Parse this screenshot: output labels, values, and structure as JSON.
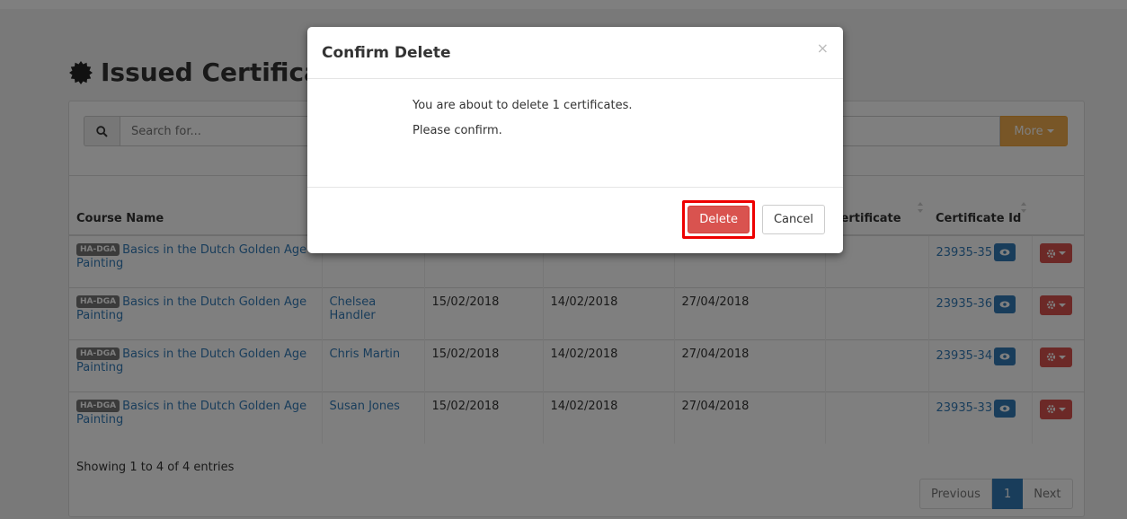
{
  "page": {
    "title": "Issued Certificates"
  },
  "search": {
    "placeholder": "Search for...",
    "more_label": "More"
  },
  "table": {
    "headers": [
      "Course Name",
      "",
      "",
      "",
      "",
      "Certificate",
      "Certificate Id",
      ""
    ],
    "rows": [
      {
        "badge": "HA-DGA",
        "course": "Basics in the Dutch Golden Age Painting",
        "student": "",
        "d1": "",
        "d2": "",
        "d3": "",
        "cert_id": "23935-35"
      },
      {
        "badge": "HA-DGA",
        "course": "Basics in the Dutch Golden Age Painting",
        "student": "Chelsea Handler",
        "d1": "15/02/2018",
        "d2": "14/02/2018",
        "d3": "27/04/2018",
        "cert_id": "23935-36"
      },
      {
        "badge": "HA-DGA",
        "course": "Basics in the Dutch Golden Age Painting",
        "student": "Chris Martin",
        "d1": "15/02/2018",
        "d2": "14/02/2018",
        "d3": "27/04/2018",
        "cert_id": "23935-34"
      },
      {
        "badge": "HA-DGA",
        "course": "Basics in the Dutch Golden Age Painting",
        "student": "Susan Jones",
        "d1": "15/02/2018",
        "d2": "14/02/2018",
        "d3": "27/04/2018",
        "cert_id": "23935-33"
      }
    ]
  },
  "footer": {
    "showing": "Showing 1 to 4 of 4 entries",
    "prev": "Previous",
    "current_page": "1",
    "next": "Next"
  },
  "modal": {
    "title": "Confirm Delete",
    "close": "×",
    "message": "You are about to delete 1 certificates.",
    "confirm_text": "Please confirm.",
    "delete_label": "Delete",
    "cancel_label": "Cancel"
  },
  "icons": {
    "title_icon": "certificate-icon",
    "search_icon": "search-icon",
    "eye_icon": "eye-icon",
    "gear_icon": "gear-icon"
  },
  "colors": {
    "primary": "#337ab7",
    "danger": "#d9534f",
    "warning": "#f0ad4e",
    "highlight": "#ee0000"
  }
}
